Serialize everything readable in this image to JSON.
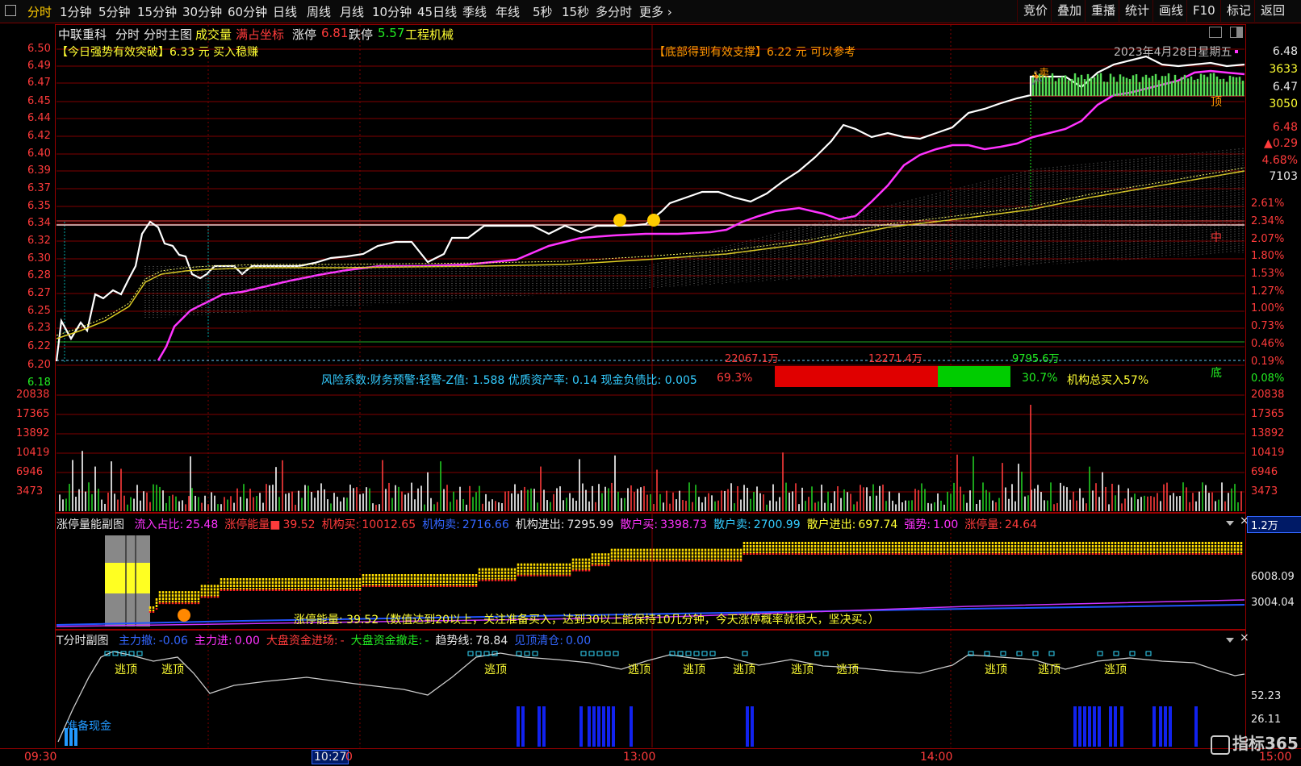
{
  "top_tabs": [
    "分时",
    "1分钟",
    "5分钟",
    "15分钟",
    "30分钟",
    "60分钟",
    "日线",
    "周线",
    "月线",
    "10分钟",
    "45日线",
    "季线",
    "年线",
    "5秒",
    "15秒",
    "多分时",
    "更多"
  ],
  "top_right_buttons": [
    "竞价",
    "叠加",
    "重播",
    "统计",
    "画线",
    "F10",
    "标记",
    "返回"
  ],
  "stock": {
    "name": "中联重科",
    "view1": "分时",
    "view2": "分时主图",
    "overlay_volume": "成交量",
    "full_coord": "满占坐标",
    "limit_up_label": "涨停",
    "limit_up_value": "6.81",
    "limit_down_label": "跌停",
    "limit_down_value": "5.57",
    "industry": "工程机械"
  },
  "signals": {
    "left_box": "【今日强势有效突破】",
    "left_price": "6.33",
    "left_unit": "元",
    "left_action": "买入稳赚",
    "right_box": "【底部得到有效支撑】",
    "right_price": "6.22",
    "right_unit": "元",
    "right_action": "可以参考",
    "date": "2023年4月28日星期五",
    "sell_mark": "卖",
    "top_mark": "顶",
    "mid_mark": "中",
    "bottom_mark": "底"
  },
  "price_axis_left": [
    "6.50",
    "6.49",
    "6.47",
    "6.45",
    "6.44",
    "6.42",
    "6.40",
    "6.39",
    "6.37",
    "6.35",
    "6.34",
    "6.32",
    "6.30",
    "6.28",
    "6.27",
    "6.25",
    "6.23",
    "6.22",
    "6.20",
    "6.18"
  ],
  "pct_axis_right": [
    "2.61%",
    "2.34%",
    "2.07%",
    "1.80%",
    "1.53%",
    "1.27%",
    "1.00%",
    "0.73%",
    "0.46%",
    "0.19%",
    "0.08%"
  ],
  "quote_panel": {
    "last": "6.48",
    "vol": "3633",
    "bid": "6.47",
    "bid_vol": "3050",
    "price": "6.48",
    "change": "▲0.29",
    "change_pct": "4.68%",
    "amount": "7103"
  },
  "flows": {
    "big_red": "22067.1万",
    "mid_red": "12271.4万",
    "green": "9795.6万",
    "risk_text": "风险系数:财务预警:轻警-Z值: 1.588 优质资产率: 0.14 现金负债比: 0.005",
    "red_pct": "69.3%",
    "green_pct": "30.7%",
    "inst_text": "机构总买入57%",
    "red_share": 0.693
  },
  "volume_axis": [
    "20838",
    "17365",
    "13892",
    "10419",
    "6946",
    "3473"
  ],
  "sub1": {
    "title": "涨停量能副图",
    "items": [
      {
        "label": "流入占比:",
        "value": "25.48",
        "color": "#ff33ff"
      },
      {
        "label": "涨停能量■",
        "value": "39.52",
        "color": "#ff3b3b"
      },
      {
        "label": "机构买:",
        "value": "10012.65",
        "color": "#ff3b3b"
      },
      {
        "label": "机构卖:",
        "value": "2716.66",
        "color": "#3366ff"
      },
      {
        "label": "机构进出:",
        "value": "7295.99",
        "color": "#e8e8e8"
      },
      {
        "label": "散户买:",
        "value": "3398.73",
        "color": "#ff33ff"
      },
      {
        "label": "散户卖:",
        "value": "2700.99",
        "color": "#33ccff"
      },
      {
        "label": "散户进出:",
        "value": "697.74",
        "color": "#ffff33"
      },
      {
        "label": "强势:",
        "value": "1.00",
        "color": "#ff33ff"
      },
      {
        "label": "涨停量:",
        "value": "24.64",
        "color": "#ff3b3b"
      }
    ],
    "scale_box": "1.2万",
    "axis": [
      "6008.09",
      "3004.04"
    ],
    "note": "涨停能量: 39.52（数值达到20以上，关注准备买入，达到30以上能保持10几分钟，今天涨停概率就很大，坚决买。）"
  },
  "sub2": {
    "title": "T分时副图",
    "items": [
      {
        "label": "主力撤:",
        "value": "-0.06",
        "color": "#3366ff"
      },
      {
        "label": "主力进:",
        "value": "0.00",
        "color": "#ff33ff"
      },
      {
        "label": "大盘资金进场:",
        "value": "-",
        "color": "#ff3b3b"
      },
      {
        "label": "大盘资金撤走:",
        "value": "-",
        "color": "#22ee22"
      },
      {
        "label": "趋势线:",
        "value": "78.84",
        "color": "#e8e8e8"
      },
      {
        "label": "见顶清仓:",
        "value": "0.00",
        "color": "#3366ff"
      }
    ],
    "axis": [
      "52.23",
      "26.11"
    ],
    "escape_label": "逃顶",
    "cash_label": "准备现金"
  },
  "time_axis": {
    "t0": "09:30",
    "cursor": "10:27",
    "cursor_tail": "0",
    "t2": "13:00",
    "t3": "14:00",
    "t4": "15:00"
  },
  "watermark": "指标365"
}
